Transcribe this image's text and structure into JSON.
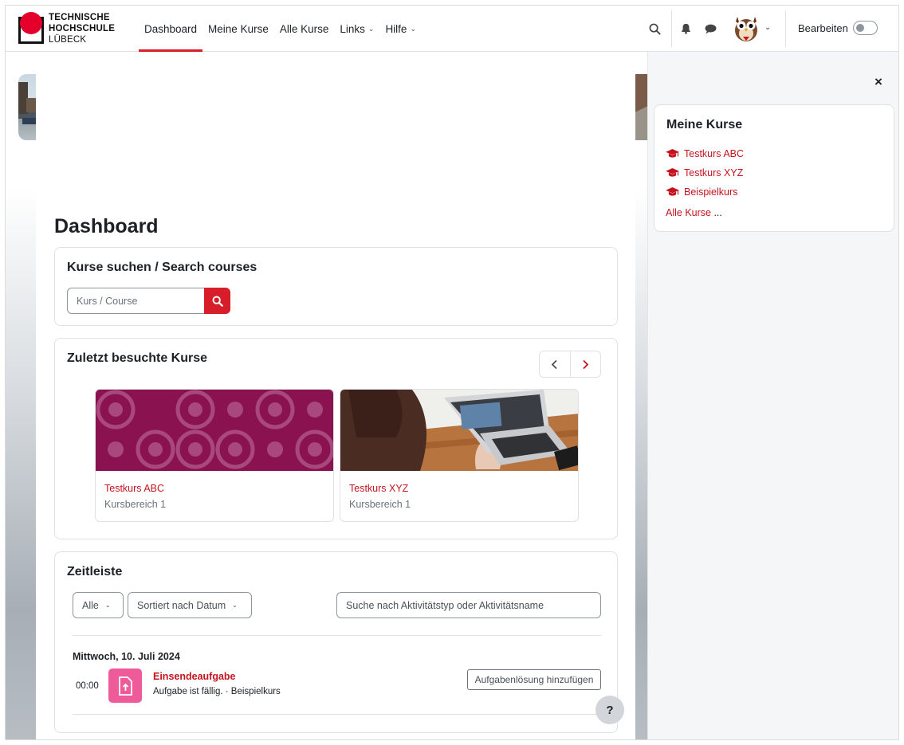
{
  "header": {
    "logo_lines": [
      "TECHNISCHE",
      "HOCHSCHULE",
      "LÜBECK"
    ],
    "nav": [
      {
        "label": "Dashboard",
        "active": true
      },
      {
        "label": "Meine Kurse"
      },
      {
        "label": "Alle Kurse"
      },
      {
        "label": "Links",
        "dropdown": true
      },
      {
        "label": "Hilfe",
        "dropdown": true
      }
    ],
    "icons": [
      "search-icon",
      "bell-icon",
      "chat-icon"
    ],
    "edit_label": "Bearbeiten",
    "edit_on": false
  },
  "main": {
    "title": "Dashboard",
    "search_block": {
      "title": "Kurse suchen / Search courses",
      "placeholder": "Kurs / Course"
    },
    "recent_block": {
      "title": "Zuletzt besuchte Kurse",
      "courses": [
        {
          "name": "Testkurs ABC",
          "category": "Kursbereich 1"
        },
        {
          "name": "Testkurs XYZ",
          "category": "Kursbereich 1"
        }
      ]
    },
    "timeline": {
      "title": "Zeitleiste",
      "filter": "Alle",
      "sort": "Sortiert nach Datum",
      "search_placeholder": "Suche nach Aktivitätstyp oder Aktivitätsname",
      "date": "Mittwoch, 10. Juli 2024",
      "event": {
        "time": "00:00",
        "name": "Einsendeaufgabe",
        "subtitle": "Aufgabe ist fällig. · Beispielkurs",
        "action": "Aufgabenlösung hinzufügen"
      }
    },
    "help_label": "?"
  },
  "drawer": {
    "close_label": "×",
    "block_title": "Meine Kurse",
    "courses": [
      "Testkurs ABC",
      "Testkurs XYZ",
      "Beispielkurs"
    ],
    "all_label": "Alle Kurse",
    "all_suffix": " ..."
  },
  "colors": {
    "brand_red": "#d71c2a",
    "link_red": "#c5141f",
    "course1_bg": "#8a1251",
    "assign_icon": "#ef5a9b"
  }
}
